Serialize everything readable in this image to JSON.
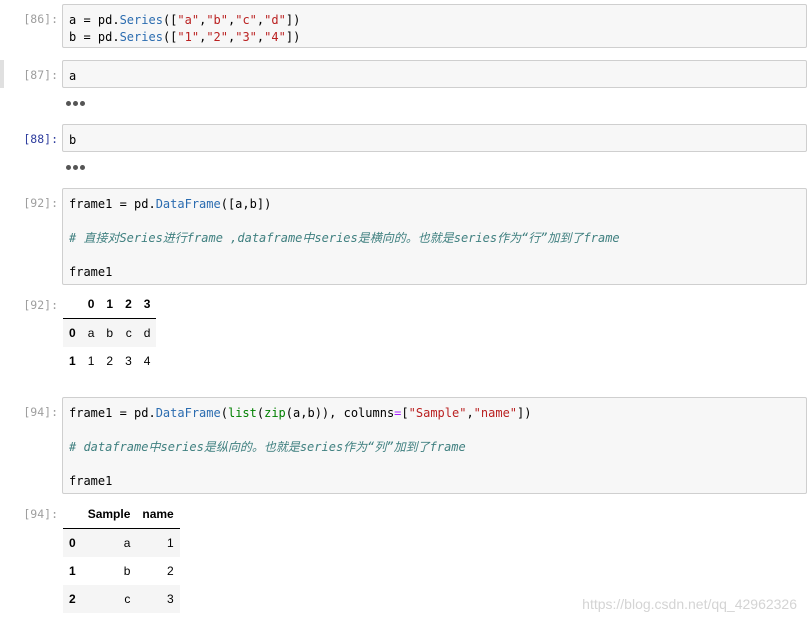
{
  "cells": [
    {
      "prompt": "[86]:",
      "lines": [
        [
          {
            "t": "a = pd.",
            "c": ""
          },
          {
            "t": "Series",
            "c": "kw-cls"
          },
          {
            "t": "([",
            "c": ""
          },
          {
            "t": "\"a\"",
            "c": "str"
          },
          {
            "t": ",",
            "c": ""
          },
          {
            "t": "\"b\"",
            "c": "str"
          },
          {
            "t": ",",
            "c": ""
          },
          {
            "t": "\"c\"",
            "c": "str"
          },
          {
            "t": ",",
            "c": ""
          },
          {
            "t": "\"d\"",
            "c": "str"
          },
          {
            "t": "])",
            "c": ""
          }
        ],
        [
          {
            "t": "b = pd.",
            "c": ""
          },
          {
            "t": "Series",
            "c": "kw-cls"
          },
          {
            "t": "([",
            "c": ""
          },
          {
            "t": "\"1\"",
            "c": "str"
          },
          {
            "t": ",",
            "c": ""
          },
          {
            "t": "\"2\"",
            "c": "str"
          },
          {
            "t": ",",
            "c": ""
          },
          {
            "t": "\"3\"",
            "c": "str"
          },
          {
            "t": ",",
            "c": ""
          },
          {
            "t": "\"4\"",
            "c": "str"
          },
          {
            "t": "])",
            "c": ""
          }
        ]
      ]
    },
    {
      "prompt": "[87]:",
      "lines": [
        [
          {
            "t": "a",
            "c": ""
          }
        ]
      ]
    },
    {
      "prompt": "[88]:",
      "lines": [
        [
          {
            "t": "b",
            "c": ""
          }
        ]
      ]
    },
    {
      "prompt": "[92]:",
      "lines": [
        [
          {
            "t": "frame1 = pd.",
            "c": ""
          },
          {
            "t": "DataFrame",
            "c": "kw-cls"
          },
          {
            "t": "([a,b])",
            "c": ""
          }
        ],
        [],
        [
          {
            "t": "# 直接对Series进行frame ,dataframe中series是横向的。也就是series作为“行”加到了frame",
            "c": "comment"
          }
        ],
        [],
        [
          {
            "t": "frame1",
            "c": ""
          }
        ]
      ]
    },
    {
      "prompt": "[94]:",
      "lines": [
        [
          {
            "t": "frame1 = pd.",
            "c": ""
          },
          {
            "t": "DataFrame",
            "c": "kw-cls"
          },
          {
            "t": "(",
            "c": ""
          },
          {
            "t": "list",
            "c": "builtin"
          },
          {
            "t": "(",
            "c": ""
          },
          {
            "t": "zip",
            "c": "builtin"
          },
          {
            "t": "(a,b)), columns",
            "c": ""
          },
          {
            "t": "=",
            "c": "op"
          },
          {
            "t": "[",
            "c": ""
          },
          {
            "t": "\"Sample\"",
            "c": "str"
          },
          {
            "t": ",",
            "c": ""
          },
          {
            "t": "\"name\"",
            "c": "str"
          },
          {
            "t": "])",
            "c": ""
          }
        ],
        [],
        [
          {
            "t": "# dataframe中series是纵向的。也就是series作为“列”加到了frame",
            "c": "comment"
          }
        ],
        [],
        [
          {
            "t": "frame1",
            "c": ""
          }
        ]
      ]
    }
  ],
  "outputs": {
    "out92": {
      "prompt": "[92]:",
      "columns": [
        "",
        "0",
        "1",
        "2",
        "3"
      ],
      "rows": [
        [
          "0",
          "a",
          "b",
          "c",
          "d"
        ],
        [
          "1",
          "1",
          "2",
          "3",
          "4"
        ]
      ]
    },
    "out94": {
      "prompt": "[94]:",
      "columns": [
        "",
        "Sample",
        "name"
      ],
      "rows": [
        [
          "0",
          "a",
          "1"
        ],
        [
          "1",
          "b",
          "2"
        ],
        [
          "2",
          "c",
          "3"
        ]
      ]
    }
  },
  "watermark": "https://blog.csdn.net/qq_42962326"
}
